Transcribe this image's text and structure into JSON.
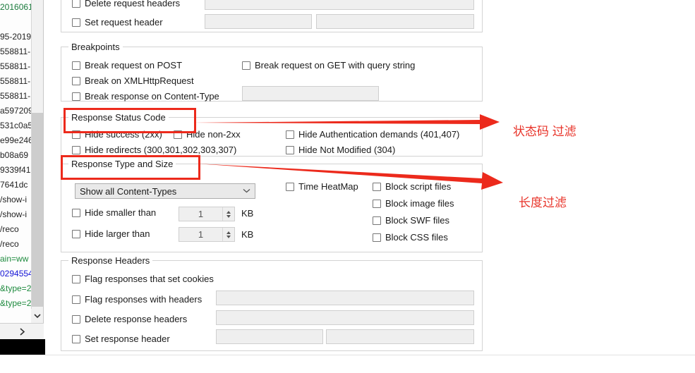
{
  "window": {
    "app": "fiddler-options-filters-tab"
  },
  "sidebar": {
    "lines": [
      {
        "text": "2016061",
        "style": "first"
      },
      {
        "text": "",
        "style": "gap"
      },
      {
        "text": "95-2019",
        "style": "plain"
      },
      {
        "text": "558811-",
        "style": "plain"
      },
      {
        "text": "558811-",
        "style": "plain"
      },
      {
        "text": "558811-",
        "style": "plain"
      },
      {
        "text": "558811-",
        "style": "plain"
      },
      {
        "text": "a597209",
        "style": "plain"
      },
      {
        "text": "531c0a5",
        "style": "plain"
      },
      {
        "text": "e99e246",
        "style": "plain"
      },
      {
        "text": "b08a69",
        "style": "plain"
      },
      {
        "text": "9339f41",
        "style": "plain"
      },
      {
        "text": "7641dc",
        "style": "plain"
      },
      {
        "text": "/show-i",
        "style": "plain"
      },
      {
        "text": "/show-i",
        "style": "plain"
      },
      {
        "text": "/reco",
        "style": "plain"
      },
      {
        "text": "/reco",
        "style": "plain"
      },
      {
        "text": "ain=ww",
        "style": "green"
      },
      {
        "text": "0294554",
        "style": "blue"
      },
      {
        "text": "&type=2",
        "style": "green"
      },
      {
        "text": "&type=2",
        "style": "green"
      }
    ],
    "scroll_down_icon": "chevron-down-icon",
    "hsplit_icon": "chevron-right-icon"
  },
  "request_headers_partial": {
    "delete_request_headers": "Delete request headers",
    "set_request_header": "Set request header"
  },
  "breakpoints": {
    "legend": "Breakpoints",
    "break_request_post": "Break request on POST",
    "break_xmlhttprequest": "Break on XMLHttpRequest",
    "break_response_content_type": "Break response on Content-Type",
    "break_request_get_query": "Break request on GET with query string",
    "content_type_value": ""
  },
  "response_status_code": {
    "legend": "Response Status Code",
    "hide_success": "Hide success (2xx)",
    "hide_non_2xx": "Hide non-2xx",
    "hide_redirects": "Hide redirects (300,301,302,303,307)",
    "hide_auth_demands": "Hide Authentication demands (401,407)",
    "hide_not_modified": "Hide Not Modified (304)"
  },
  "response_type_and_size": {
    "legend": "Response Type and Size",
    "content_types_selected": "Show all Content-Types",
    "chevron": "chevron-down-icon",
    "hide_smaller_than": "Hide smaller than",
    "hide_larger_than": "Hide larger than",
    "smaller_value": "1",
    "larger_value": "1",
    "unit_smaller": "KB",
    "unit_larger": "KB",
    "time_heatmap": "Time HeatMap",
    "block_script_files": "Block script files",
    "block_image_files": "Block image files",
    "block_swf_files": "Block SWF files",
    "block_css_files": "Block CSS files"
  },
  "response_headers": {
    "legend": "Response Headers",
    "flag_set_cookies": "Flag responses that set cookies",
    "flag_with_headers": "Flag responses with headers",
    "delete_response_headers": "Delete response headers",
    "set_response_header": "Set response header",
    "flag_with_headers_value": "",
    "delete_response_headers_value": "",
    "set_response_header_name": "",
    "set_response_header_value": ""
  },
  "annotations": {
    "status_code_label": "状态码 过滤",
    "length_filter_label": "长度过滤",
    "accent": "#ec2a1c"
  }
}
